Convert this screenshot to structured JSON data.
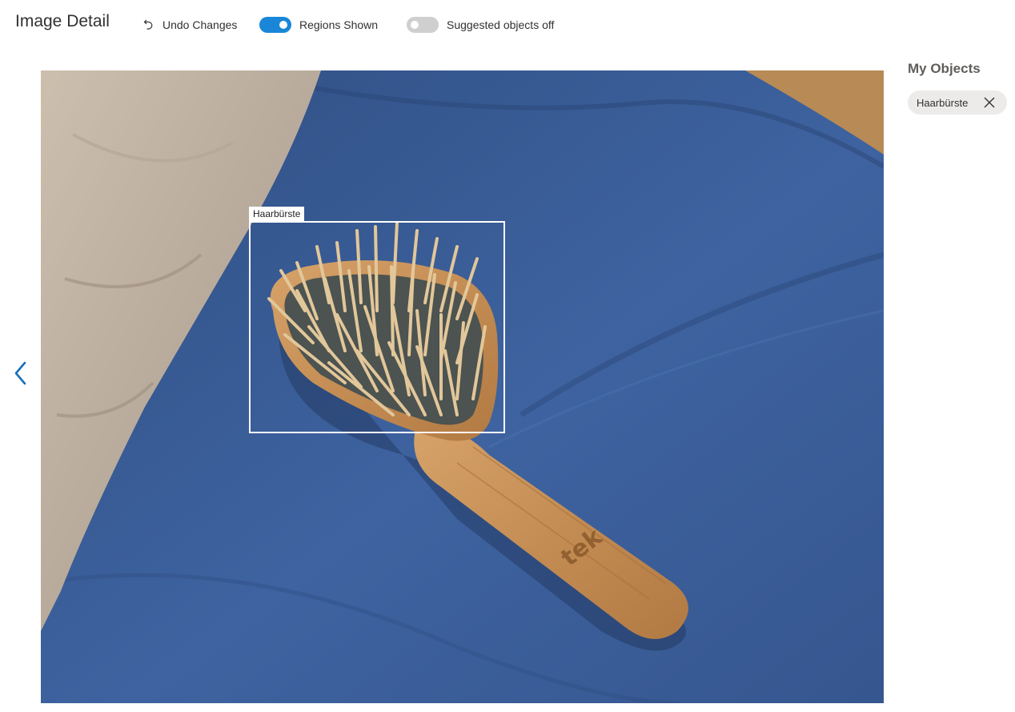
{
  "header": {
    "title": "Image Detail",
    "undo_label": "Undo Changes",
    "undo_icon": "undo-icon"
  },
  "toggles": {
    "regions": {
      "label": "Regions Shown",
      "on": true
    },
    "suggested": {
      "label": "Suggested objects off",
      "on": false
    }
  },
  "navigation": {
    "prev_icon": "chevron-left-icon"
  },
  "image": {
    "description_icon": "photo",
    "region_label": "Haarbürste",
    "brush_brand": "tek"
  },
  "side_panel": {
    "title": "My Objects",
    "objects": [
      {
        "label": "Haarbürste",
        "remove_icon": "close-icon"
      }
    ]
  },
  "colors": {
    "accent": "#1a86d8",
    "toggle_off": "#cfcfcf",
    "chip_bg": "#edebe9",
    "blanket": "#3d5e93"
  }
}
